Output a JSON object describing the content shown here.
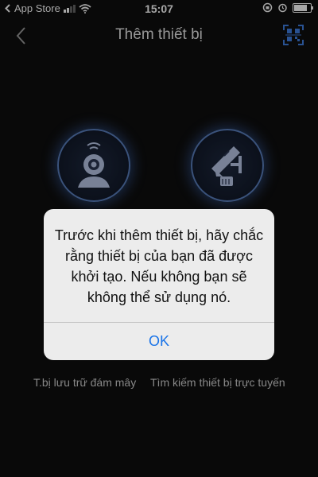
{
  "status_bar": {
    "back_app": "App Store",
    "time": "15:07",
    "battery_level": 0.9
  },
  "nav": {
    "title": "Thêm thiết bị",
    "back_icon": "chevron-left-icon",
    "qr_icon": "qr-scan-icon"
  },
  "options": [
    {
      "label": "T.bị lưu trữ đám mây",
      "icon": "cloud-camera-icon"
    },
    {
      "label": "Tìm kiếm thiết bị trực tuyến",
      "icon": "cctv-camera-icon"
    }
  ],
  "dialog": {
    "message": "Trước khi thêm thiết bị, hãy chắc rằng thiết bị của bạn đã được khởi tạo. Nếu không bạn sẽ không thể sử dụng nó.",
    "ok_label": "OK"
  },
  "colors": {
    "accent": "#1a74e8",
    "icon_blue": "#5a7fbd",
    "background": "#0e0e0e"
  }
}
